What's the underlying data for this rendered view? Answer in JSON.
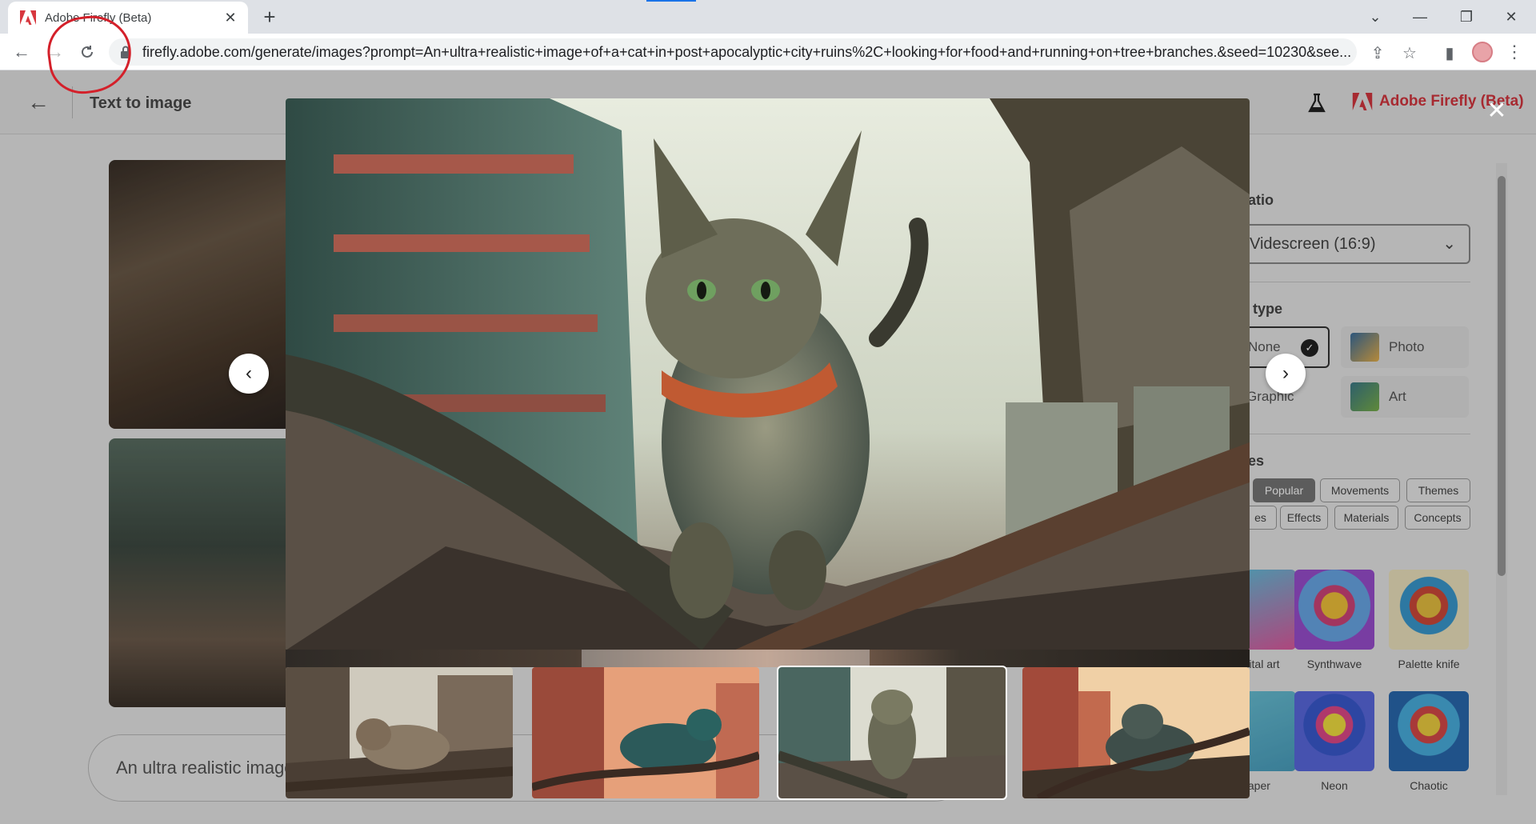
{
  "browser": {
    "tab_title": "Adobe Firefly (Beta)",
    "url": "firefly.adobe.com/generate/images?prompt=An+ultra+realistic+image+of+a+cat+in+post+apocalyptic+city+ruins%2C+looking+for+food+and+running+on+tree+branches.&seed=10230&see..."
  },
  "header": {
    "page_title": "Text to image",
    "brand_name": "Adobe Firefly (Beta)"
  },
  "prompt": {
    "text": "An ultra realistic image"
  },
  "panel": {
    "aspect_ratio_label": "atio",
    "aspect_ratio_value": "Videscreen (16:9)",
    "content_type_label": "type",
    "content_types": [
      {
        "label": "None",
        "selected": true
      },
      {
        "label": "Photo",
        "selected": false
      },
      {
        "label": "Graphic",
        "selected": false
      },
      {
        "label": "Art",
        "selected": false
      }
    ],
    "styles_label": "es",
    "chips_row1": [
      {
        "label": "Popular",
        "active": true
      },
      {
        "label": "Movements",
        "active": false
      },
      {
        "label": "Themes",
        "active": false
      }
    ],
    "chips_row2": [
      {
        "label": "es",
        "active": false
      },
      {
        "label": "Effects",
        "active": false
      },
      {
        "label": "Materials",
        "active": false
      },
      {
        "label": "Concepts",
        "active": false
      }
    ],
    "style_cards": [
      {
        "label": "Digital art"
      },
      {
        "label": "Synthwave"
      },
      {
        "label": "Palette knife"
      },
      {
        "label": "paper"
      },
      {
        "label": "Neon"
      },
      {
        "label": "Chaotic"
      }
    ]
  },
  "lightbox": {
    "current_index": 2,
    "thumbnail_count": 4
  },
  "colors": {
    "adobe_red": "#d7373f",
    "annotation_red": "#d4202a"
  }
}
